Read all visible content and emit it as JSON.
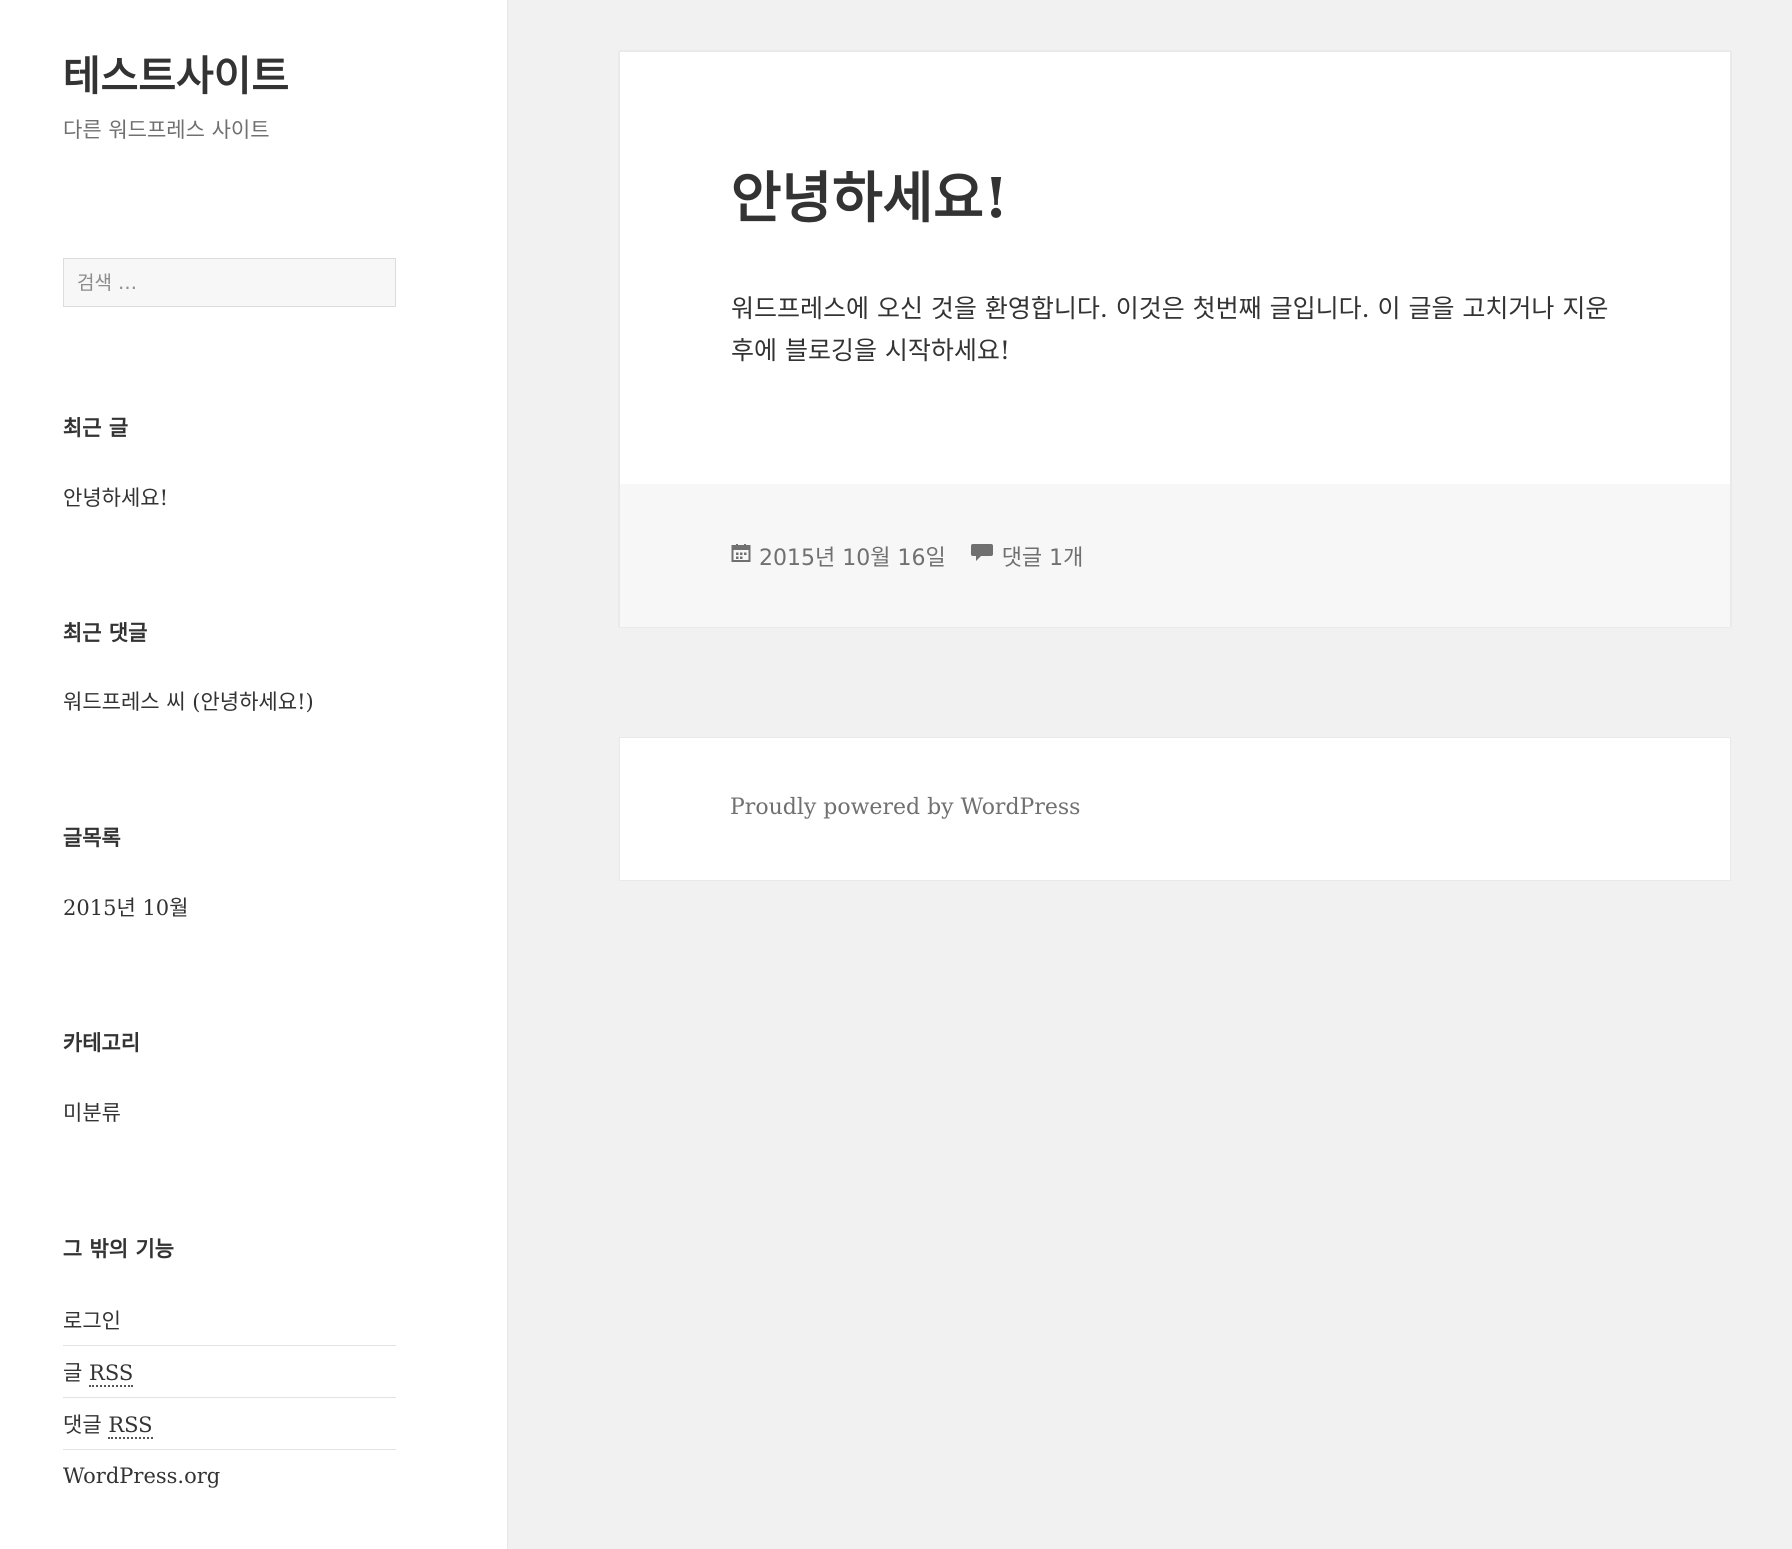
{
  "site": {
    "title": "테스트사이트",
    "description": "다른 워드프레스 사이트"
  },
  "search": {
    "placeholder": "검색 …"
  },
  "widgets": {
    "recent_posts": {
      "title": "최근 글",
      "items": [
        "안녕하세요!"
      ]
    },
    "recent_comments": {
      "title": "최근 댓글",
      "items": [
        "워드프레스 씨 (안녕하세요!)"
      ]
    },
    "archives": {
      "title": "글목록",
      "items": [
        "2015년 10월"
      ]
    },
    "categories": {
      "title": "카테고리",
      "items": [
        "미분류"
      ]
    },
    "meta": {
      "title": "그 밖의 기능",
      "login": "로그인",
      "entries_prefix": "글",
      "comments_prefix": "댓글",
      "rss": "RSS",
      "wordpress_org": "WordPress.org"
    }
  },
  "post": {
    "title": "안녕하세요!",
    "body": "워드프레스에 오신 것을 환영합니다. 이것은 첫번째 글입니다. 이 글을 고치거나 지운 후에 블로깅을 시작하세요!",
    "date": "2015년 10월 16일",
    "comments": "댓글 1개",
    "date_icon": "calendar-icon",
    "comments_icon": "comment-bubble-icon"
  },
  "footer": {
    "powered_by": "Proudly powered by WordPress"
  },
  "colors": {
    "page_bg": "#f1f1f1",
    "card_bg": "#ffffff",
    "text": "#333333",
    "muted": "#707070"
  }
}
